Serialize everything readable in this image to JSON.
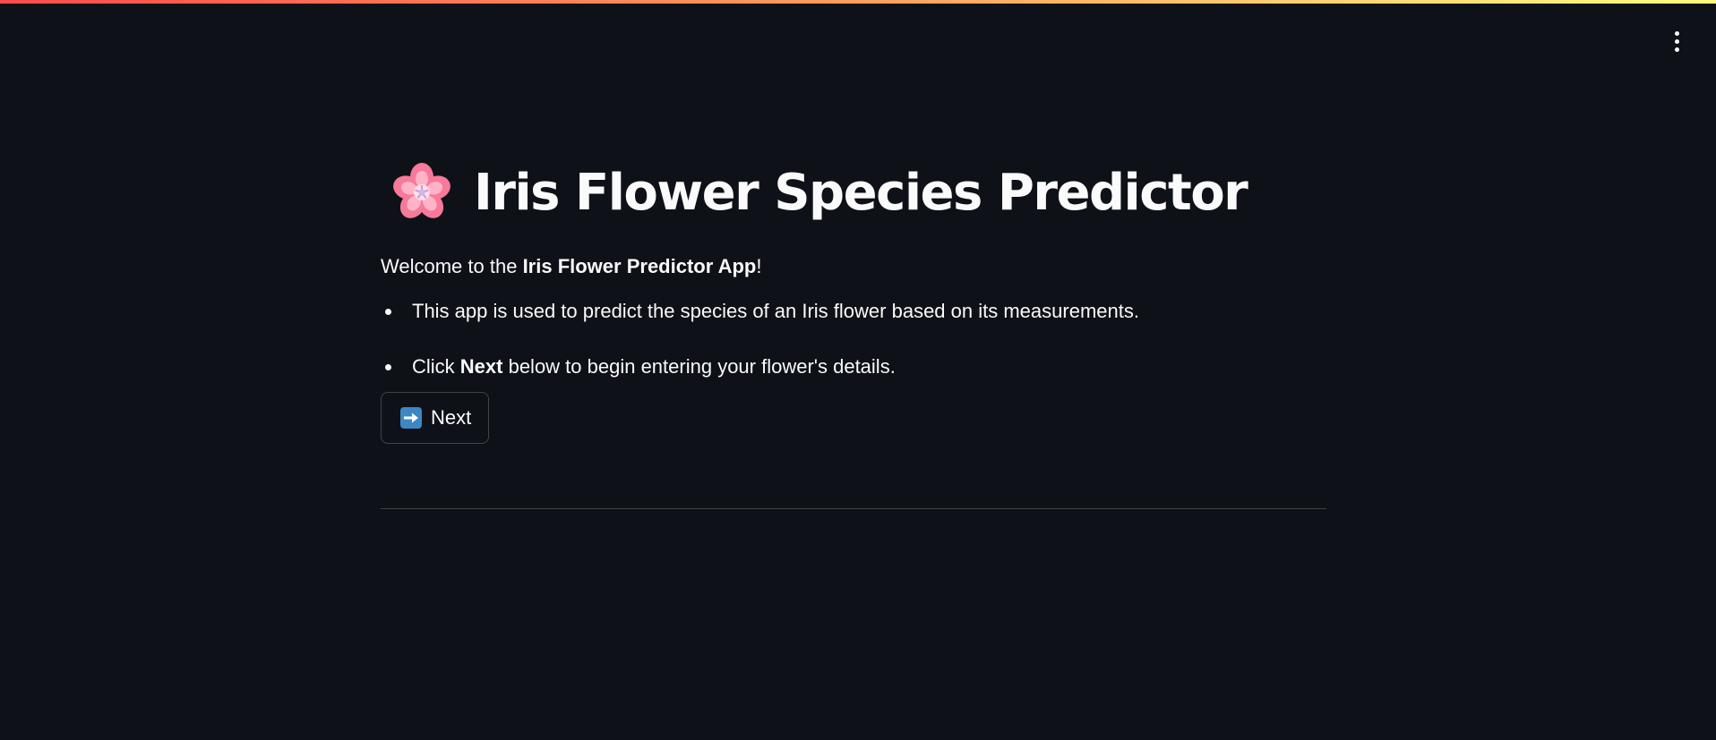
{
  "theme": {
    "background": "#0e1117",
    "text": "#fafafa",
    "decoration_gradient": [
      "#ff4b4b",
      "#fffd80"
    ]
  },
  "header": {
    "menu_icon": "vertical-ellipsis-icon"
  },
  "main": {
    "title_icon": "cherry-blossom-icon",
    "title": "Iris Flower Species Predictor",
    "welcome_prefix": "Welcome to the ",
    "welcome_bold": "Iris Flower Predictor App",
    "welcome_suffix": "!",
    "bullet_1": "This app is used to predict the species of an Iris flower based on its measurements.",
    "bullet_2_prefix": "Click ",
    "bullet_2_bold": "Next",
    "bullet_2_suffix": " below to begin entering your flower's details.",
    "next_button": {
      "icon": "right-arrow-icon",
      "label": "Next"
    }
  }
}
